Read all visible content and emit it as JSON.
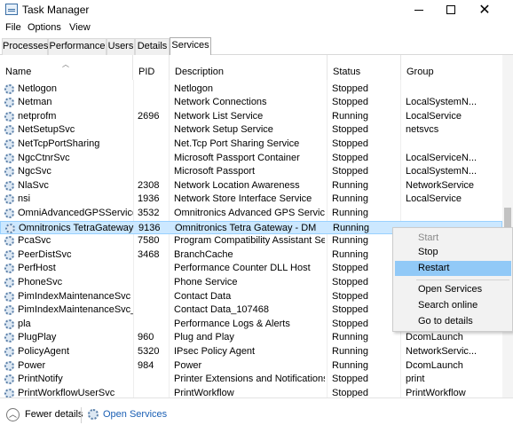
{
  "window": {
    "title": "Task Manager"
  },
  "menu": [
    "File",
    "Options",
    "View"
  ],
  "tabs": [
    "Processes",
    "Performance",
    "Users",
    "Details",
    "Services"
  ],
  "active_tab": "Services",
  "columns": [
    "Name",
    "PID",
    "Description",
    "Status",
    "Group"
  ],
  "rows": [
    [
      "Netlogon",
      "",
      "Netlogon",
      "Stopped",
      ""
    ],
    [
      "Netman",
      "",
      "Network Connections",
      "Stopped",
      "LocalSystemN..."
    ],
    [
      "netprofm",
      "2696",
      "Network List Service",
      "Running",
      "LocalService"
    ],
    [
      "NetSetupSvc",
      "",
      "Network Setup Service",
      "Stopped",
      "netsvcs"
    ],
    [
      "NetTcpPortSharing",
      "",
      "Net.Tcp Port Sharing Service",
      "Stopped",
      ""
    ],
    [
      "NgcCtnrSvc",
      "",
      "Microsoft Passport Container",
      "Stopped",
      "LocalServiceN..."
    ],
    [
      "NgcSvc",
      "",
      "Microsoft Passport",
      "Stopped",
      "LocalSystemN..."
    ],
    [
      "NlaSvc",
      "2308",
      "Network Location Awareness",
      "Running",
      "NetworkService"
    ],
    [
      "nsi",
      "1936",
      "Network Store Interface Service",
      "Running",
      "LocalService"
    ],
    [
      "OmniAdvancedGPSService",
      "3532",
      "Omnitronics Advanced GPS Service",
      "Running",
      ""
    ],
    [
      "Omnitronics TetraGateway-...",
      "9136",
      "Omnitronics Tetra Gateway - DM",
      "Running",
      ""
    ],
    [
      "PcaSvc",
      "7580",
      "Program Compatibility Assistant Ser...",
      "Running",
      ""
    ],
    [
      "PeerDistSvc",
      "3468",
      "BranchCache",
      "Running",
      ""
    ],
    [
      "PerfHost",
      "",
      "Performance Counter DLL Host",
      "Stopped",
      ""
    ],
    [
      "PhoneSvc",
      "",
      "Phone Service",
      "Stopped",
      ""
    ],
    [
      "PimIndexMaintenanceSvc",
      "",
      "Contact Data",
      "Stopped",
      ""
    ],
    [
      "PimIndexMaintenanceSvc_...",
      "",
      "Contact Data_107468",
      "Stopped",
      ""
    ],
    [
      "pla",
      "",
      "Performance Logs & Alerts",
      "Stopped",
      ""
    ],
    [
      "PlugPlay",
      "960",
      "Plug and Play",
      "Running",
      "DcomLaunch"
    ],
    [
      "PolicyAgent",
      "5320",
      "IPsec Policy Agent",
      "Running",
      "NetworkServic..."
    ],
    [
      "Power",
      "984",
      "Power",
      "Running",
      "DcomLaunch"
    ],
    [
      "PrintNotify",
      "",
      "Printer Extensions and Notifications",
      "Stopped",
      "print"
    ],
    [
      "PrintWorkflowUserSvc",
      "",
      "PrintWorkflow",
      "Stopped",
      "PrintWorkflow"
    ]
  ],
  "selected_row": 10,
  "context_menu": {
    "items": [
      {
        "label": "Start",
        "disabled": true
      },
      {
        "label": "Stop",
        "disabled": false
      },
      {
        "label": "Restart",
        "disabled": false,
        "highlighted": true
      },
      {
        "label": "Open Services",
        "disabled": false
      },
      {
        "label": "Search online",
        "disabled": false
      },
      {
        "label": "Go to details",
        "disabled": false
      }
    ]
  },
  "footer": {
    "fewer_details": "Fewer details",
    "open_services": "Open Services"
  },
  "colors": {
    "selection": "#cce8ff",
    "menu_highlight": "#91c9f7",
    "link": "#1a5fb4"
  }
}
